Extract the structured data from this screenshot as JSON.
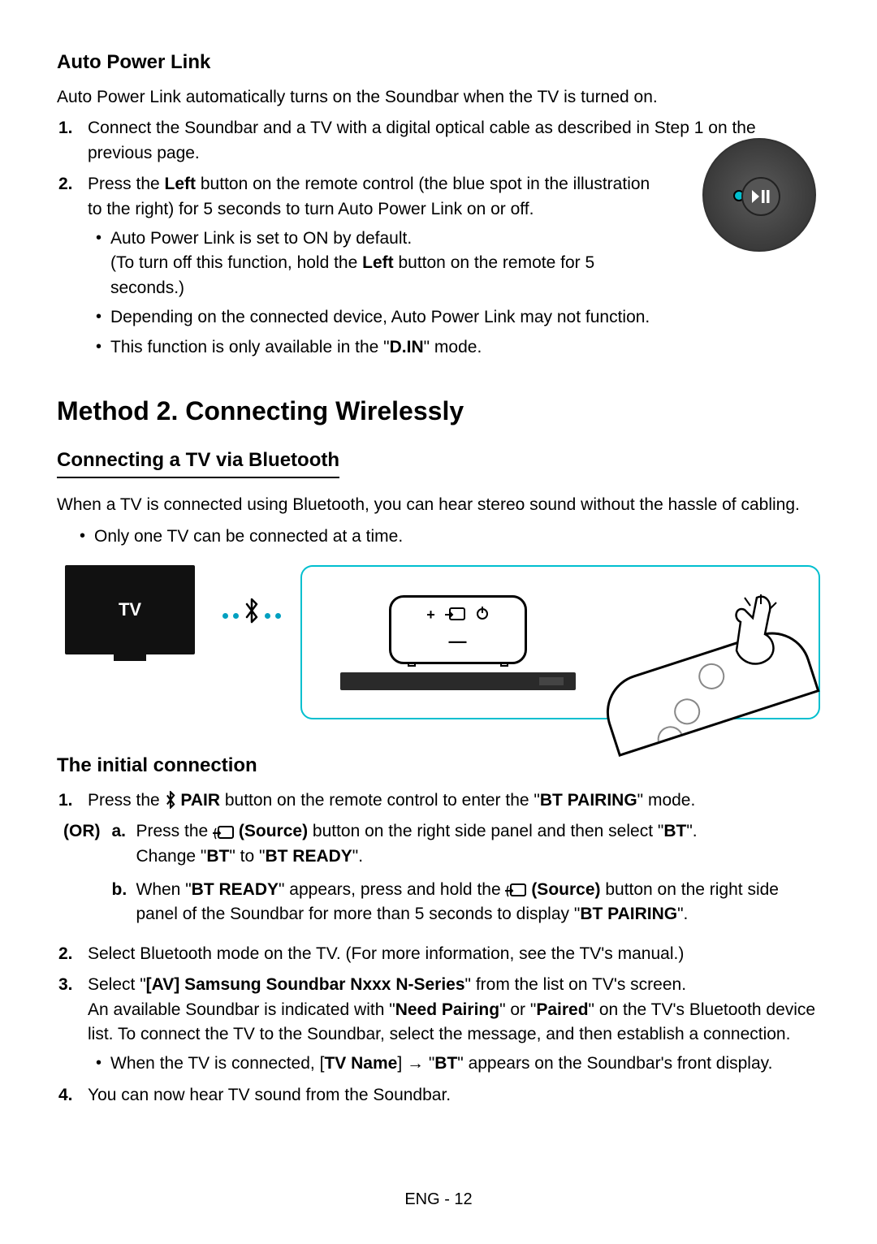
{
  "section1": {
    "title": "Auto Power Link",
    "intro": "Auto Power Link automatically turns on the Soundbar when the TV is turned on.",
    "steps": [
      "Connect the Soundbar and a TV with a digital optical cable as described in Step 1 on the previous page.",
      "Press the Left button on the remote control (the blue spot in the illustration to the right) for 5 seconds to turn Auto Power Link on or off."
    ],
    "step2_label_bold": "Left",
    "bullets": {
      "b1_pre": "Auto Power Link is set to ON by default.",
      "b1_sub_pre": "(To turn off this function, hold the ",
      "b1_sub_bold": "Left",
      "b1_sub_post": " button on the remote for 5 seconds.)",
      "b2": "Depending on the connected device, Auto Power Link may not function.",
      "b3_pre": "This function is only available in the \"",
      "b3_bold": "D.IN",
      "b3_post": "\" mode."
    }
  },
  "method2": {
    "title": "Method 2. Connecting Wirelessly",
    "subtitle": "Connecting a TV via Bluetooth",
    "intro": "When a TV is connected using Bluetooth, you can hear stereo sound without the hassle of cabling.",
    "bullet": "Only one TV can be connected at a time.",
    "tv_label": "TV",
    "or_label": "OR"
  },
  "initial": {
    "title": "The initial connection",
    "or_label": "(OR)",
    "step1_pre": "Press the ",
    "step1_bold1": " PAIR",
    "step1_mid": " button on the remote control to enter the \"",
    "step1_bold2": "BT PAIRING",
    "step1_post": "\" mode.",
    "a_pre": "Press the ",
    "a_bold1": " (Source)",
    "a_mid": " button on the right side panel and then select \"",
    "a_bold2": "BT",
    "a_post": "\".",
    "a_line2_pre": "Change \"",
    "a_line2_b1": "BT",
    "a_line2_mid": "\" to \"",
    "a_line2_b2": "BT READY",
    "a_line2_post": "\".",
    "b_pre": "When \"",
    "b_bold1": "BT READY",
    "b_mid1": "\" appears, press and hold the ",
    "b_bold2": " (Source)",
    "b_mid2": " button on the right side panel of the Soundbar for more than 5 seconds to display \"",
    "b_bold3": "BT PAIRING",
    "b_post": "\".",
    "step2": "Select Bluetooth mode on the TV. (For more information, see the TV's manual.)",
    "step3_pre": "Select \"",
    "step3_bold1": "[AV] Samsung Soundbar Nxxx N-Series",
    "step3_mid1": "\" from the list on TV's screen.",
    "step3_line2_pre": "An available Soundbar is indicated with \"",
    "step3_b2": "Need Pairing",
    "step3_mid2": "\" or \"",
    "step3_b3": "Paired",
    "step3_post2": "\" on the TV's Bluetooth device list. To connect the TV to the Soundbar, select the message, and then establish a connection.",
    "step3_bullet_pre": "When the TV is connected, [",
    "step3_bullet_b1": "TV Name",
    "step3_bullet_mid": "] → \"",
    "step3_bullet_b2": "BT",
    "step3_bullet_post": "\" appears on the Soundbar's front display.",
    "step4": "You can now hear TV sound from the Soundbar."
  },
  "footer": "ENG - 12",
  "icons": {
    "play_pause": "▶II",
    "bluetooth": "✱"
  }
}
